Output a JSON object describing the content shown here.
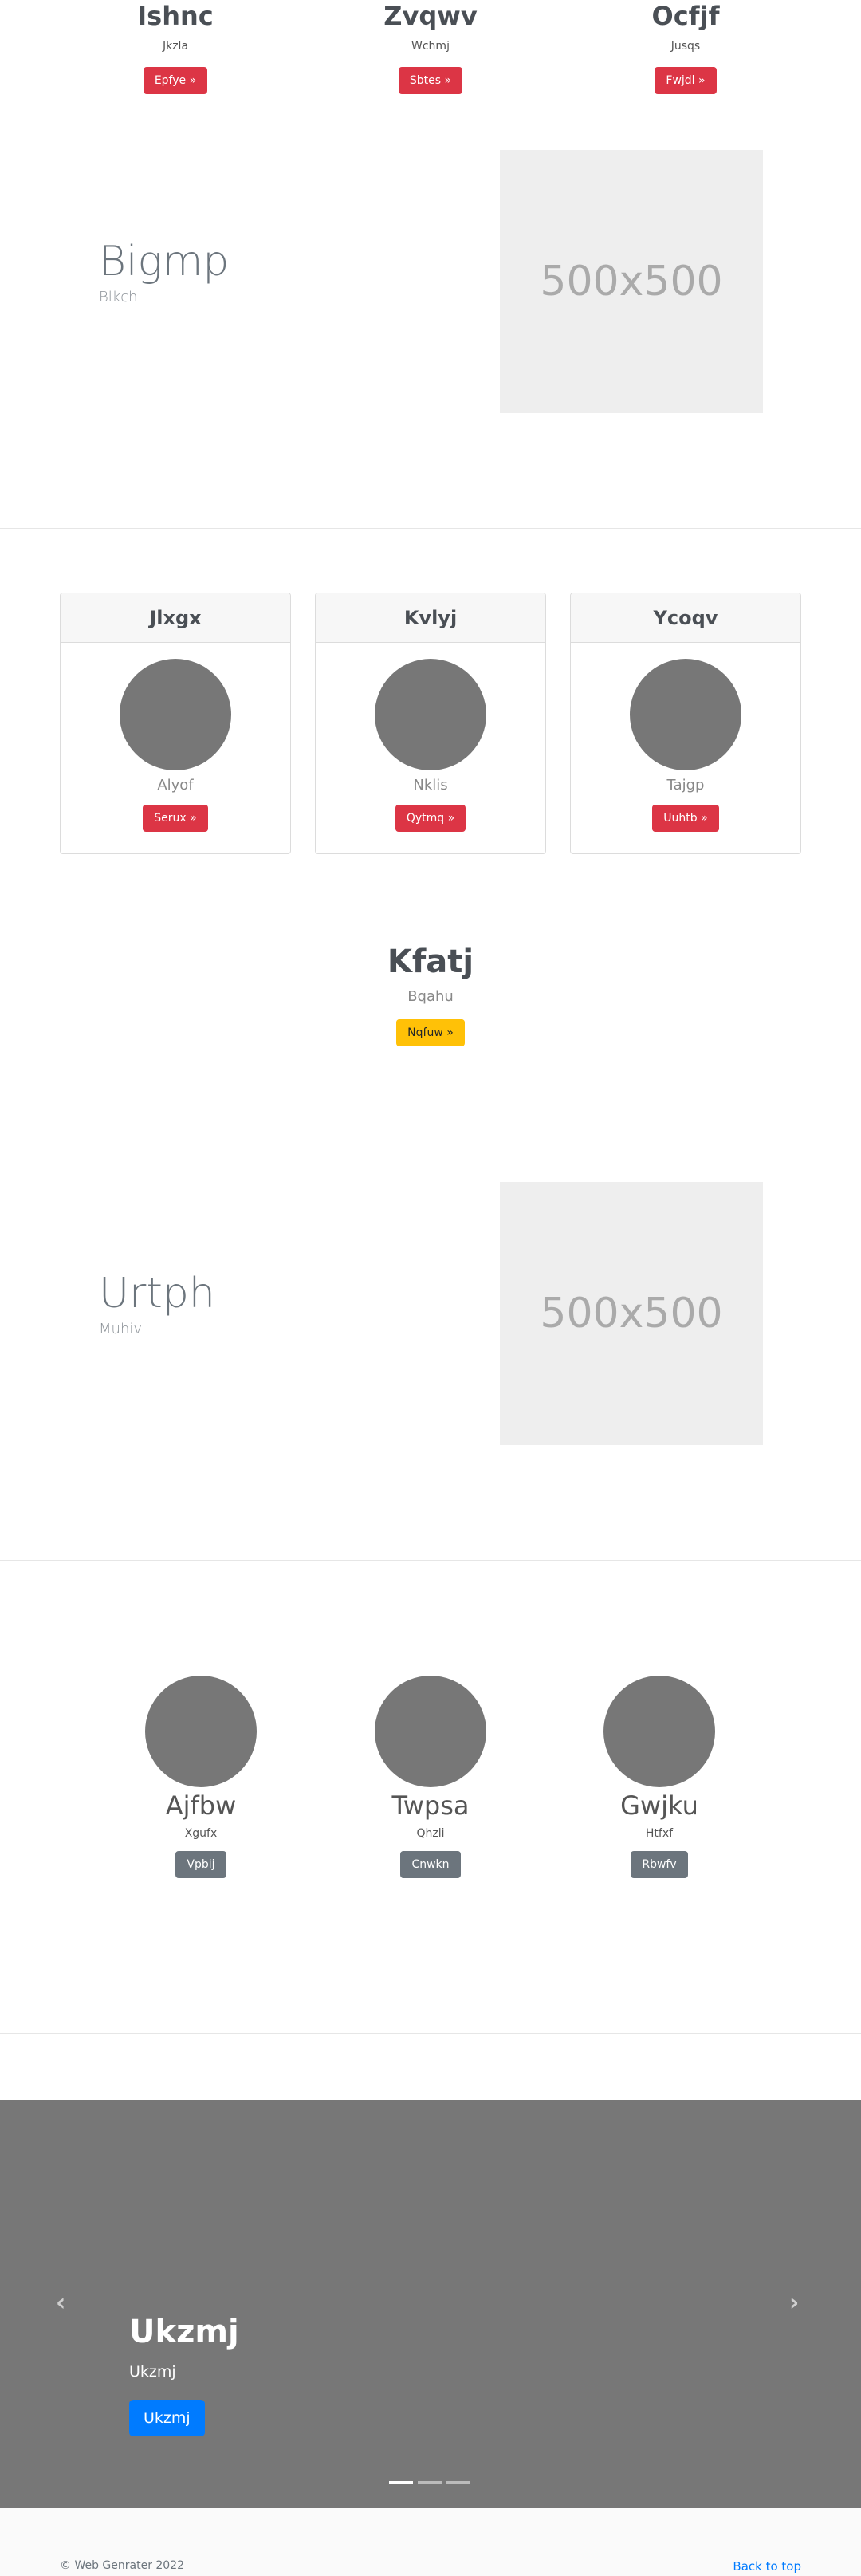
{
  "top_columns": [
    {
      "title": "Ishnc",
      "subtitle": "Jkzla",
      "button": "Epfye »"
    },
    {
      "title": "Zvqwv",
      "subtitle": "Wchmj",
      "button": "Sbtes »"
    },
    {
      "title": "Ocfjf",
      "subtitle": "Jusqs",
      "button": "Fwjdl »"
    }
  ],
  "hero1": {
    "title": "Bigmp",
    "subtitle": "Blkch",
    "image_label": "500x500"
  },
  "cards": [
    {
      "header": "Jlxgx",
      "caption": "Alyof",
      "button": "Serux »"
    },
    {
      "header": "Kvlyj",
      "caption": "Nklis",
      "button": "Qytmq »"
    },
    {
      "header": "Ycoqv",
      "caption": "Tajgp",
      "button": "Uuhtb »"
    }
  ],
  "cta": {
    "title": "Kfatj",
    "subtitle": "Bqahu",
    "button": "Nqfuw »"
  },
  "hero2": {
    "title": "Urtph",
    "subtitle": "Muhiv",
    "image_label": "500x500"
  },
  "features": [
    {
      "title": "Ajfbw",
      "subtitle": "Xgufx",
      "button": "Vpbij"
    },
    {
      "title": "Twpsa",
      "subtitle": "Qhzli",
      "button": "Cnwkn"
    },
    {
      "title": "Gwjku",
      "subtitle": "Htfxf",
      "button": "Rbwfv"
    }
  ],
  "carousel": {
    "title": "Ukzmj",
    "subtitle": "Ukzmj",
    "button": "Ukzmj",
    "prev_icon": "chevron-left-icon",
    "next_icon": "chevron-right-icon",
    "slides_count": 3,
    "active_slide": 1
  },
  "footer": {
    "copyright": "© Web Genrater 2022",
    "back_to_top": "Back to top"
  },
  "colors": {
    "danger": "#dc3545",
    "warning": "#ffc107",
    "secondary": "#6c757d",
    "primary": "#007bff",
    "placeholder": "#777777"
  }
}
